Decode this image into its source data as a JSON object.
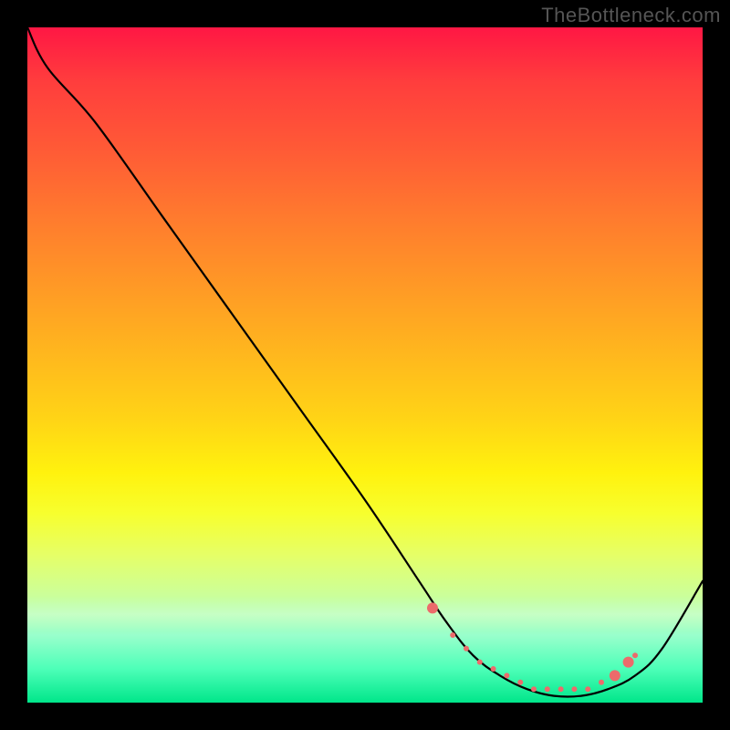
{
  "watermark": "TheBottleneck.com",
  "chart_data": {
    "type": "line",
    "title": "",
    "xlabel": "",
    "ylabel": "",
    "xlim": [
      0,
      100
    ],
    "ylim": [
      0,
      100
    ],
    "grid": false,
    "legend_position": "none",
    "series": [
      {
        "name": "curve",
        "color": "#000000",
        "x": [
          0,
          3,
          10,
          20,
          30,
          40,
          50,
          58,
          62,
          66,
          70,
          74,
          78,
          82,
          86,
          90,
          94,
          100
        ],
        "y": [
          100,
          94,
          86,
          72,
          58,
          44,
          30,
          18,
          12,
          7,
          4,
          2,
          1,
          1,
          2,
          4,
          8,
          18
        ]
      }
    ],
    "markers": {
      "name": "highlight-dots",
      "color": "#ec6b6b",
      "radius_large": 6,
      "radius_small": 3,
      "points": [
        {
          "x": 60,
          "y": 14,
          "r": "large"
        },
        {
          "x": 63,
          "y": 10,
          "r": "small"
        },
        {
          "x": 65,
          "y": 8,
          "r": "small"
        },
        {
          "x": 67,
          "y": 6,
          "r": "small"
        },
        {
          "x": 69,
          "y": 5,
          "r": "small"
        },
        {
          "x": 71,
          "y": 4,
          "r": "small"
        },
        {
          "x": 73,
          "y": 3,
          "r": "small"
        },
        {
          "x": 75,
          "y": 2,
          "r": "small"
        },
        {
          "x": 77,
          "y": 2,
          "r": "small"
        },
        {
          "x": 79,
          "y": 2,
          "r": "small"
        },
        {
          "x": 81,
          "y": 2,
          "r": "small"
        },
        {
          "x": 83,
          "y": 2,
          "r": "small"
        },
        {
          "x": 85,
          "y": 3,
          "r": "small"
        },
        {
          "x": 87,
          "y": 4,
          "r": "large"
        },
        {
          "x": 89,
          "y": 6,
          "r": "large"
        },
        {
          "x": 90,
          "y": 7,
          "r": "small"
        }
      ]
    }
  }
}
